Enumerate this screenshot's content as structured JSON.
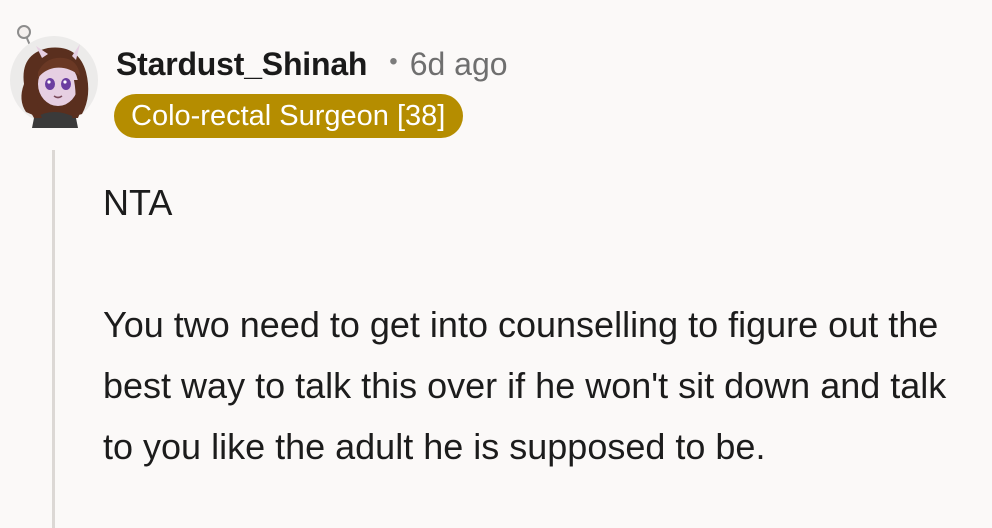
{
  "comment": {
    "author": {
      "username": "Stardust_Shinah",
      "avatar_icon": "user-avatar-icon"
    },
    "separator": "•",
    "timestamp": "6d ago",
    "flair": {
      "text": "Colo-rectal Surgeon [38]",
      "color": "#b58d00"
    },
    "body": {
      "paragraph_1": "NTA",
      "paragraph_2": "You two need to get into counselling to figure out the best way to talk this over if he won't sit down and talk to you like the adult he is supposed to be."
    }
  }
}
